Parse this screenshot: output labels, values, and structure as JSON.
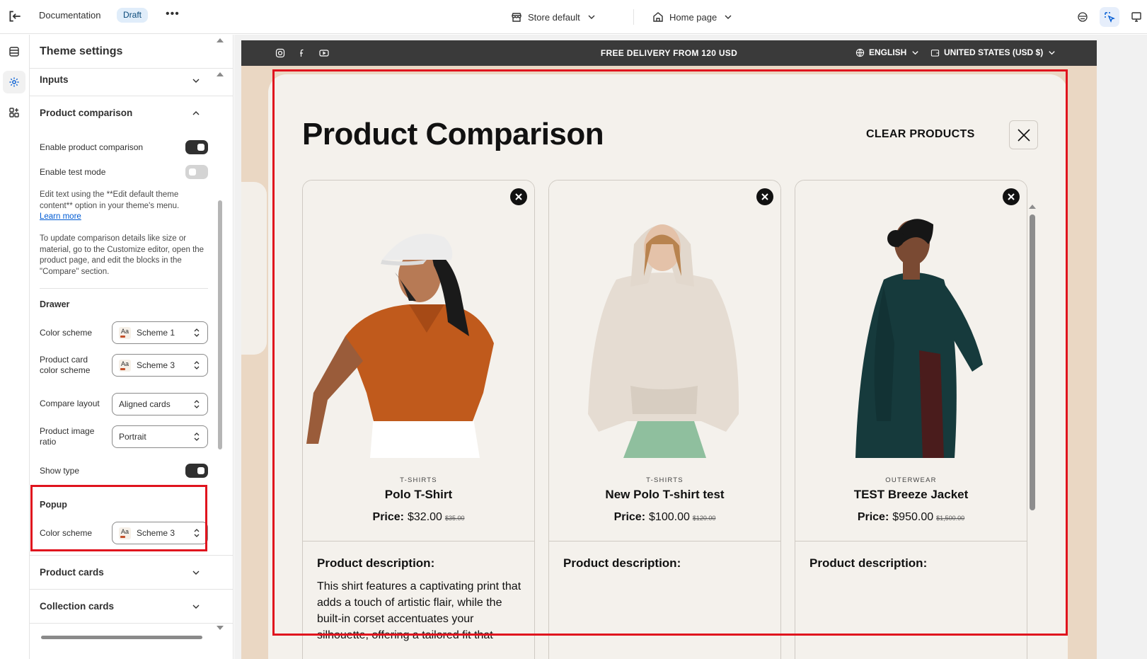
{
  "topbar": {
    "doc_title": "Documentation",
    "badge": "Draft",
    "more": "•••",
    "store_select": "Store default",
    "page_select": "Home page"
  },
  "panel": {
    "title": "Theme settings",
    "sections": {
      "inputs": "Inputs",
      "product_comparison": "Product comparison",
      "product_cards": "Product cards",
      "collection_cards": "Collection cards"
    },
    "enable_comparison_label": "Enable product comparison",
    "enable_comparison_on": true,
    "enable_test_label": "Enable test mode",
    "enable_test_on": false,
    "help1_text": "Edit text using the **Edit default theme content** option in your theme's menu.",
    "help1_link": "Learn more",
    "help2_text": "To update comparison details like size or material, go to the Customize editor, open the product page, and edit the blocks in the \"Compare\" section.",
    "drawer_heading": "Drawer",
    "color_scheme_label": "Color scheme",
    "color_scheme_value": "Scheme 1",
    "card_scheme_label": "Product card color scheme",
    "card_scheme_value": "Scheme 3",
    "compare_layout_label": "Compare layout",
    "compare_layout_value": "Aligned cards",
    "image_ratio_label": "Product image ratio",
    "image_ratio_value": "Portrait",
    "show_type_label": "Show type",
    "show_type_on": true,
    "popup_heading": "Popup",
    "popup_scheme_label": "Color scheme",
    "popup_scheme_value": "Scheme 3",
    "swatch_text": "Aa"
  },
  "preview": {
    "announcement": "FREE DELIVERY FROM 120 USD",
    "language": "ENGLISH",
    "currency": "UNITED STATES (USD $)",
    "popup": {
      "title": "Product Comparison",
      "clear_label": "CLEAR PRODUCTS",
      "products": [
        {
          "type": "T-SHIRTS",
          "name": "Polo T-Shirt",
          "price_label": "Price:",
          "price": "$32.00",
          "compare_price": "$35.00",
          "desc_heading": "Product description:",
          "description": "This shirt features a captivating print that adds a touch of artistic flair, while the built-in corset accentuates your silhouette, offering a tailored fit that"
        },
        {
          "type": "T-SHIRTS",
          "name": "New Polo T-shirt test",
          "price_label": "Price:",
          "price": "$100.00",
          "compare_price": "$120.00",
          "desc_heading": "Product description:",
          "description": ""
        },
        {
          "type": "OUTERWEAR",
          "name": "TEST Breeze Jacket",
          "price_label": "Price:",
          "price": "$950.00",
          "compare_price": "$1,500.00",
          "desc_heading": "Product description:",
          "description": ""
        }
      ]
    }
  },
  "colors": {
    "accent_red": "#e0141e",
    "announcement_bg": "#3a3a3a",
    "popup_bg": "#f4f1ec",
    "store_bg": "#ead7c3"
  }
}
